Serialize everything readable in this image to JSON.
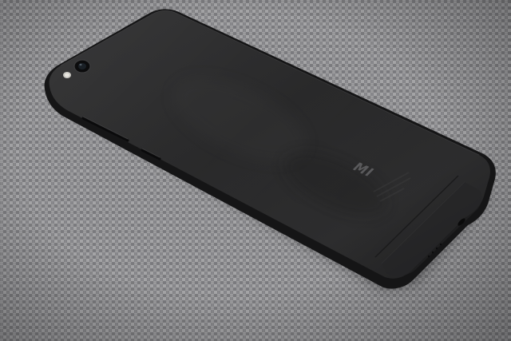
{
  "scene": {
    "subject": "smartphone-back",
    "background": "grey-woven-fabric"
  },
  "logo": {
    "text": "MI"
  },
  "colors": {
    "fabric_light": "#a3a3a5",
    "fabric_dark": "#6f6f72",
    "phone_body": "#2a2a2b",
    "phone_edge": "#141415",
    "phone_highlight": "#3b3b3c",
    "logo": "#5a5a5c"
  }
}
